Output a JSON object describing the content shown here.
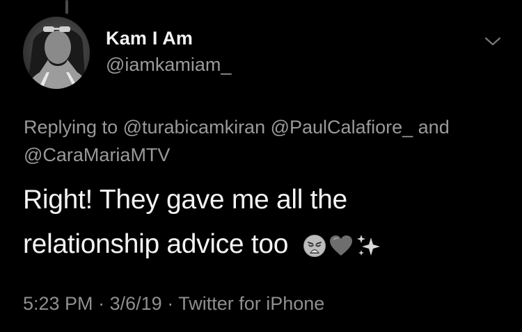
{
  "author": {
    "name": "Kam I Am",
    "handle": "@iamkamiam_"
  },
  "reply": {
    "prefix": "Replying to",
    "mentions": [
      "@turabicamkiran",
      "@PaulCalafiore_",
      "@CaraMariaMTV"
    ],
    "conjunction": "and"
  },
  "tweet": {
    "line1": "Right! They gave me all the",
    "line2": "relationship advice too",
    "emojis": [
      "weary-face-emoji",
      "heart-emoji",
      "sparkles-emoji"
    ]
  },
  "meta": {
    "time": "5:23 PM",
    "separator": "·",
    "date": "3/6/19",
    "source": "Twitter for iPhone"
  },
  "icons": {
    "menu": "chevron-down-icon"
  },
  "colors": {
    "background": "#000000",
    "primary_text": "#f4f4f4",
    "secondary_text": "#9a9a9a"
  }
}
